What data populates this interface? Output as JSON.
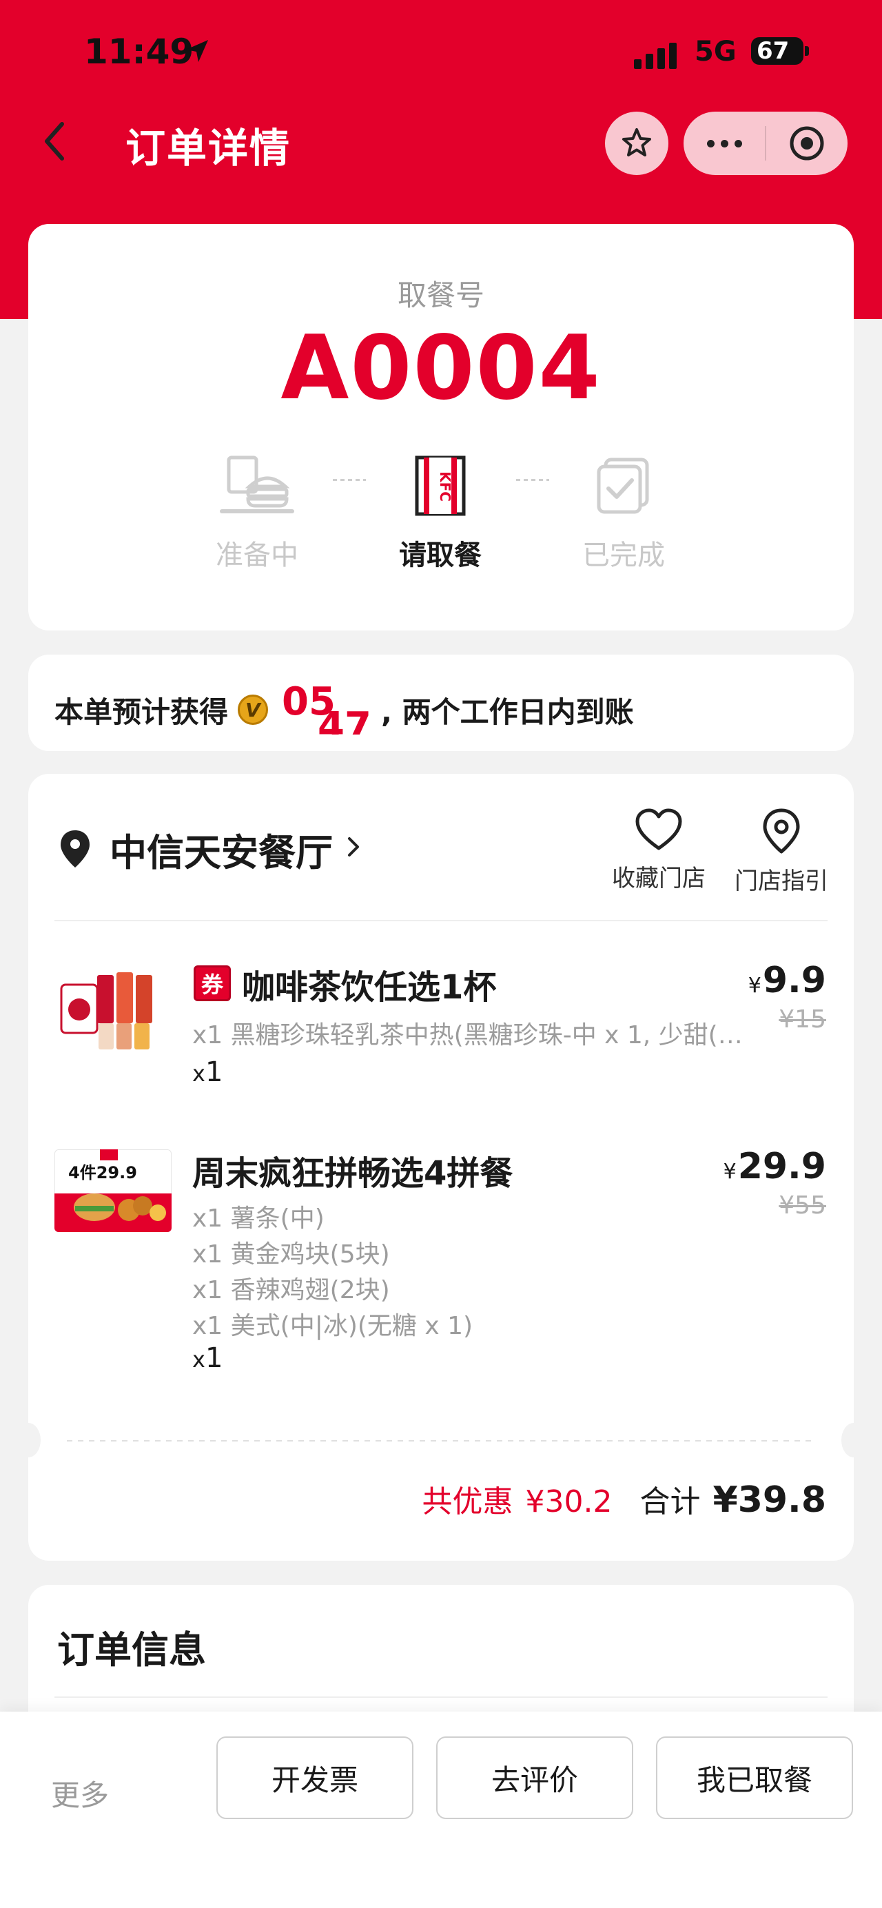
{
  "status_bar": {
    "time": "11:49",
    "network": "5G",
    "battery": "67"
  },
  "header": {
    "title": "订单详情"
  },
  "pickup": {
    "label": "取餐号",
    "number": "A0004",
    "steps": [
      {
        "label": "准备中",
        "state": "done"
      },
      {
        "label": "请取餐",
        "state": "active"
      },
      {
        "label": "已完成",
        "state": "pending"
      }
    ]
  },
  "points": {
    "prefix": "本单预计获得",
    "coin_letter": "V",
    "rolling_digits": [
      "05",
      "47"
    ],
    "suffix": ", 两个工作日内到账"
  },
  "store": {
    "name": "中信天安餐厅",
    "favorite_label": "收藏门店",
    "guide_label": "门店指引"
  },
  "items": [
    {
      "tag": "券",
      "name": "咖啡茶饮任选1杯",
      "detail": "x1 黑糖珍珠轻乳茶中热(黑糖珍珠-中 x 1, 少甜(…",
      "qty": "1",
      "qty_prefix": "x",
      "currency": "¥",
      "price": "9.9",
      "original_price": "¥15"
    },
    {
      "name": "周末疯狂拼畅选4拼餐",
      "details": [
        "x1 薯条(中)",
        "x1 黄金鸡块(5块)",
        "x1 香辣鸡翅(2块)",
        "x1 美式(中|冰)(无糖 x 1)"
      ],
      "qty": "1",
      "qty_prefix": "x",
      "currency": "¥",
      "price": "29.9",
      "original_price": "¥55",
      "image_text": "4件29.9"
    }
  ],
  "totals": {
    "discount_label": "共优惠",
    "discount": "¥30.2",
    "total_label": "合计",
    "total": "¥39.8"
  },
  "order_info": {
    "title": "订单信息"
  },
  "bottom_bar": {
    "more": "更多",
    "invoice": "开发票",
    "review": "去评价",
    "picked_up": "我已取餐"
  },
  "colors": {
    "brand_red": "#e3002b",
    "muted": "#9a9a9a"
  }
}
